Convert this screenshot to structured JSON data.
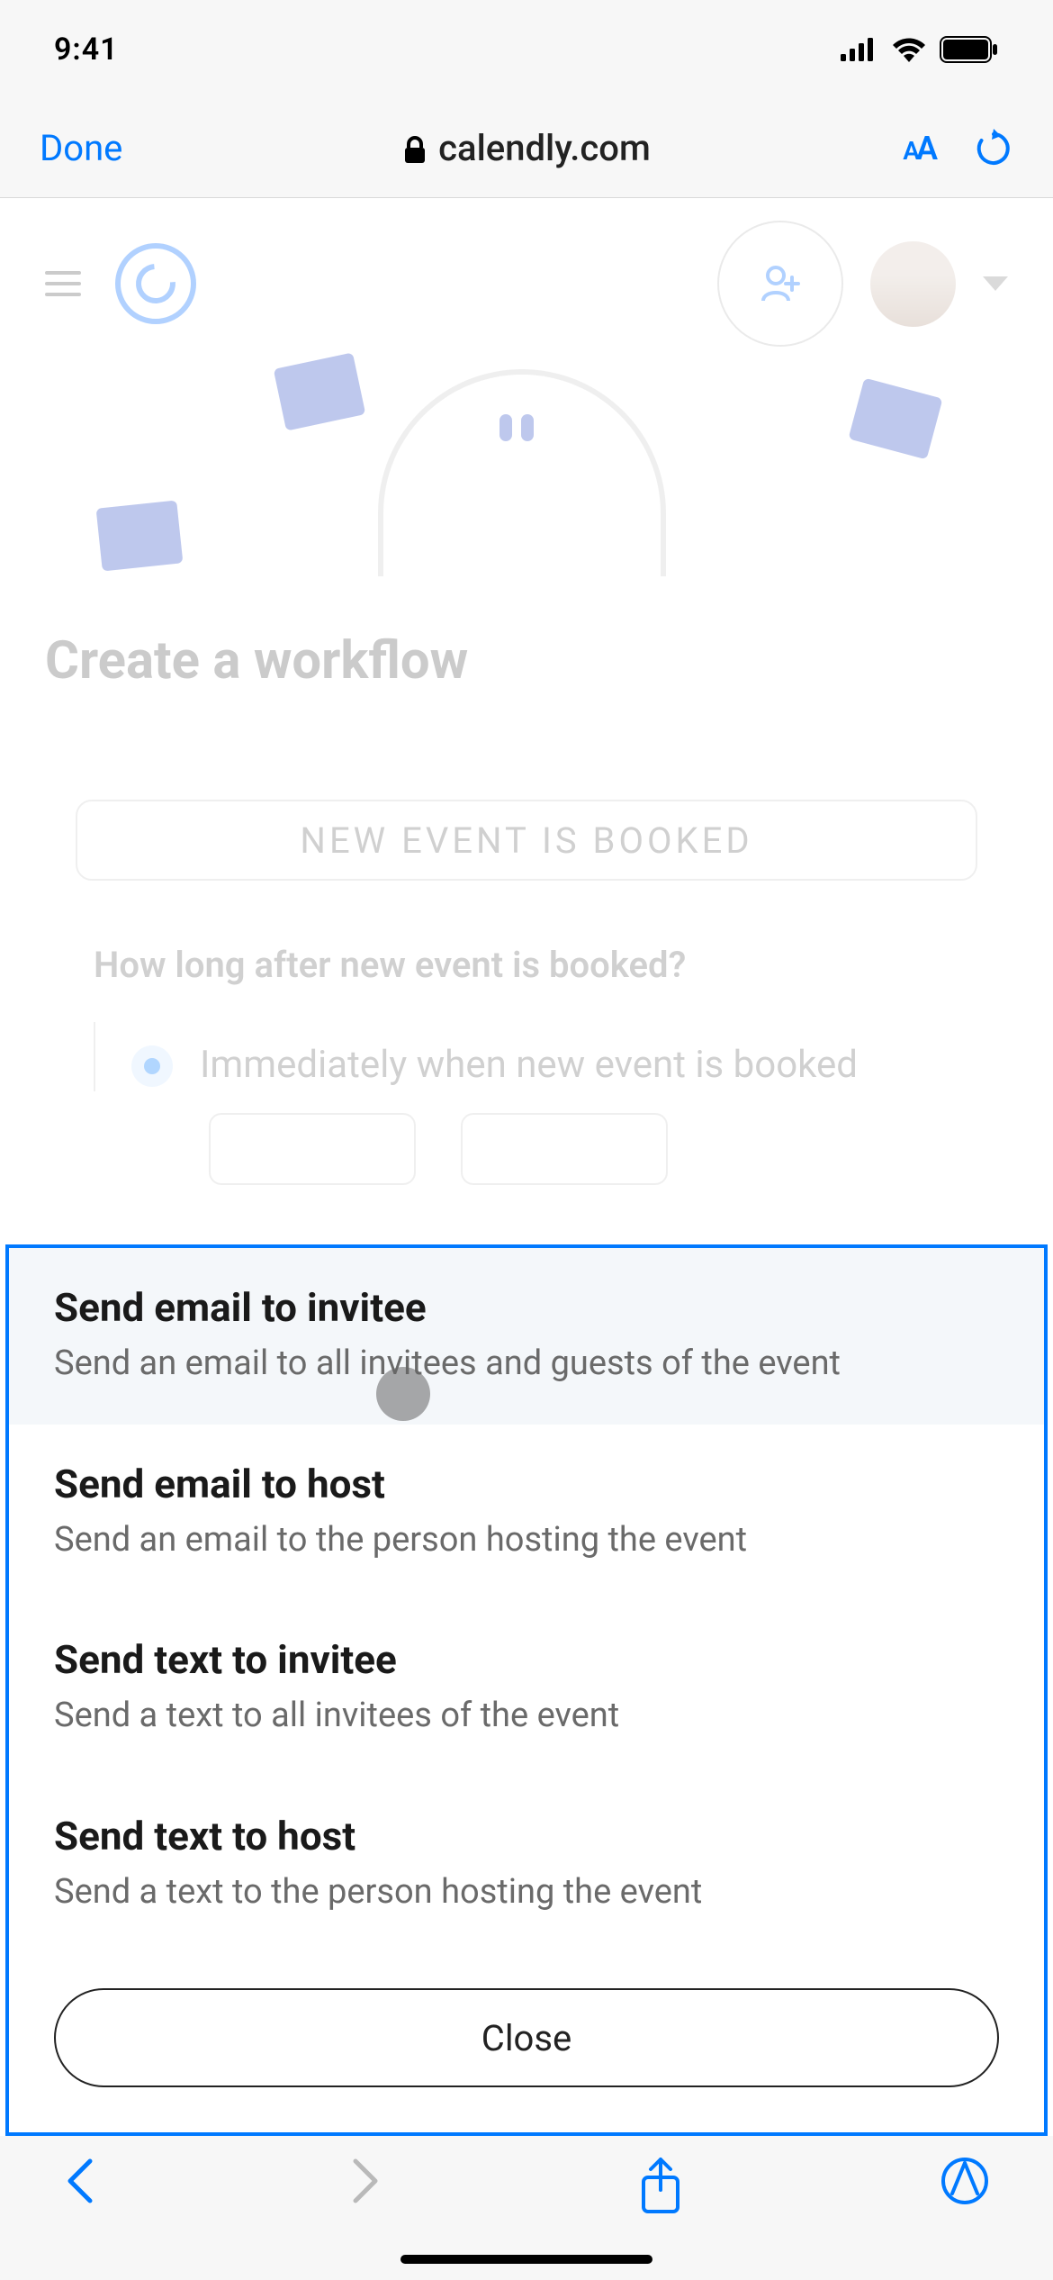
{
  "status": {
    "time": "9:41"
  },
  "safari": {
    "done": "Done",
    "url": "calendly.com",
    "aA_small": "A",
    "aA_big": "A"
  },
  "page": {
    "title": "Create a workflow",
    "triggerBox": "New event is booked",
    "question": "How long after new event is booked?",
    "radio": "Immediately when new event is booked"
  },
  "sheet": {
    "items": [
      {
        "title": "Send email to invitee",
        "desc": "Send an email to all invitees and guests of the event"
      },
      {
        "title": "Send email to host",
        "desc": "Send an email to the person hosting the event"
      },
      {
        "title": "Send text to invitee",
        "desc": "Send a text to all invitees of the event"
      },
      {
        "title": "Send text to host",
        "desc": "Send a text to the person hosting the event"
      }
    ],
    "close": "Close"
  }
}
